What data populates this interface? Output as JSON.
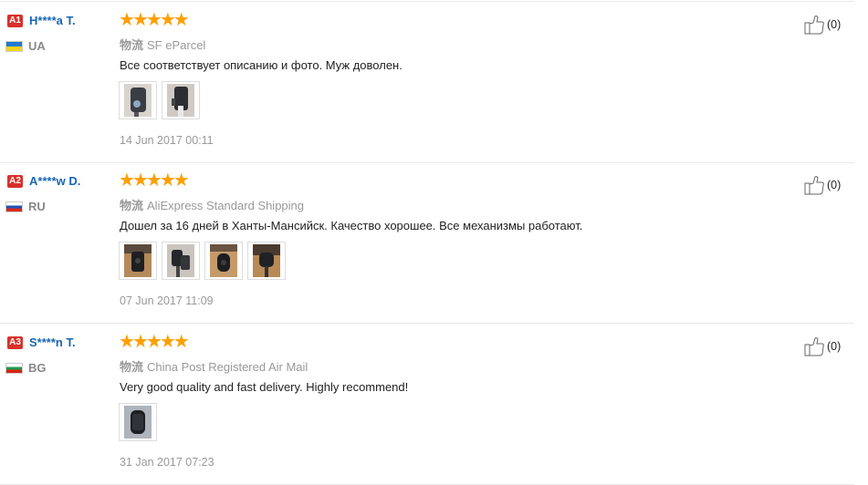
{
  "reviews": [
    {
      "level": "A1",
      "name": "H****a T.",
      "country": "UA",
      "rating": 5,
      "logistics_label": "物流",
      "logistics": "SF eParcel",
      "comment": "Все соответствует описанию и фото. Муж доволен.",
      "photos": 2,
      "date": "14 Jun 2017 00:11",
      "helpful": "(0)"
    },
    {
      "level": "A2",
      "name": "A****w D.",
      "country": "RU",
      "rating": 5,
      "logistics_label": "物流",
      "logistics": "AliExpress Standard Shipping",
      "comment": "Дошел за 16 дней в Ханты-Мансийск. Качество хорошее. Все механизмы работают.",
      "photos": 4,
      "date": "07 Jun 2017 11:09",
      "helpful": "(0)"
    },
    {
      "level": "A3",
      "name": "S****n T.",
      "country": "BG",
      "rating": 5,
      "logistics_label": "物流",
      "logistics": "China Post Registered Air Mail",
      "comment": "Very good quality and fast delivery. Highly recommend!",
      "photos": 1,
      "date": "31 Jan 2017 07:23",
      "helpful": "(0)"
    }
  ],
  "colors": {
    "level_badge": "#d9302b",
    "username": "#1766b3",
    "star": "#ff9f00",
    "muted": "#999999"
  },
  "icons": {
    "star": "star-icon",
    "helpful": "thumbs-up-icon",
    "photo": "review-photo-thumbnail"
  }
}
